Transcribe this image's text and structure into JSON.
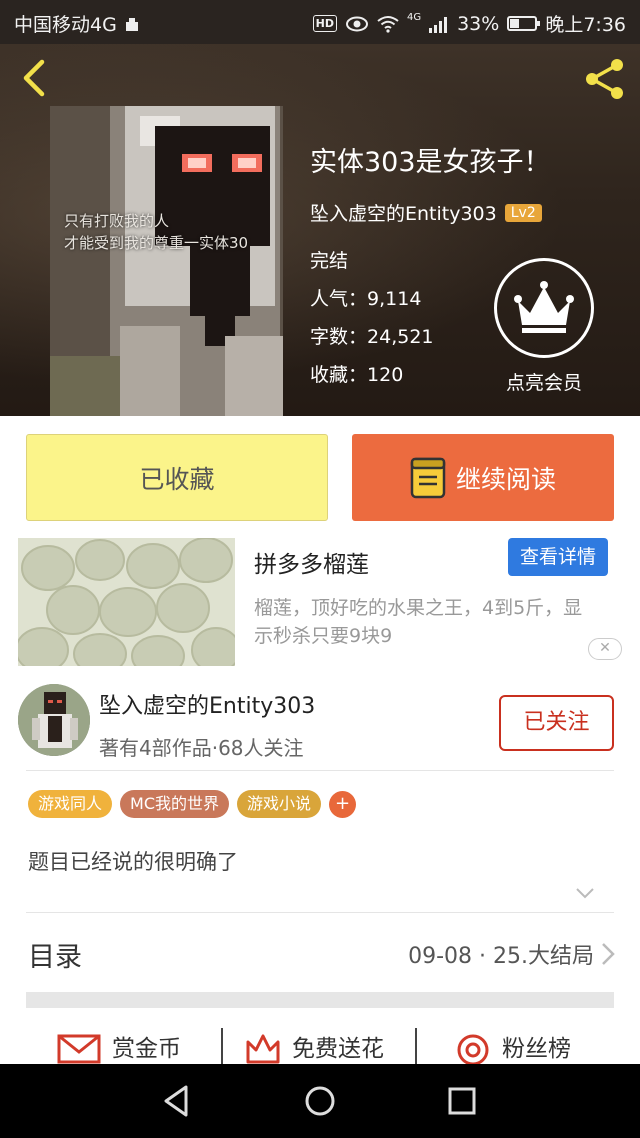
{
  "status_bar": {
    "carrier": "中国移动4G",
    "hd": "HD",
    "network": "4G",
    "battery": "33%",
    "battery_level": 0.33,
    "time": "晚上7:36"
  },
  "book": {
    "cover_text_line1": "只有打败我的人",
    "cover_text_line2": "才能受到我的尊重一实体30",
    "title": "实体303是女孩子！",
    "author": "坠入虚空的Entity303",
    "level": "Lv2",
    "status": "完结",
    "popularity_label": "人气：",
    "popularity": "9,114",
    "word_count_label": "字数：",
    "word_count": "24,521",
    "favorites_label": "收藏：",
    "favorites": "120",
    "vip_label": "点亮会员"
  },
  "actions": {
    "collected_label": "已收藏",
    "continue_label": "继续阅读"
  },
  "ad": {
    "title": "拼多多榴莲",
    "detail_button": "查看详情",
    "description": "榴莲，顶好吃的水果之王，4到5斤，显示秒杀只要9块9",
    "close_icon": "close-icon"
  },
  "author_card": {
    "name": "坠入虚空的Entity303",
    "stats": "著有4部作品·68人关注",
    "follow_label": "已关注"
  },
  "tags": [
    {
      "label": "游戏同人",
      "color": "#f0b23c"
    },
    {
      "label": "MC我的世界",
      "color": "#c9785a"
    },
    {
      "label": "游戏小说",
      "color": "#d9a53a"
    }
  ],
  "tag_add": "+",
  "summary": "题目已经说的很明确了",
  "toc": {
    "label": "目录",
    "latest": "09-08 · 25.大结局"
  },
  "bottom_actions": {
    "reward_label": "赏金币",
    "flower_label": "免费送花",
    "fans_label": "粉丝榜"
  },
  "colors": {
    "accent_orange": "#ec6b3f",
    "collected_yellow": "#fbf48a",
    "follow_red": "#c9301f",
    "detail_blue": "#2f7ae0"
  }
}
